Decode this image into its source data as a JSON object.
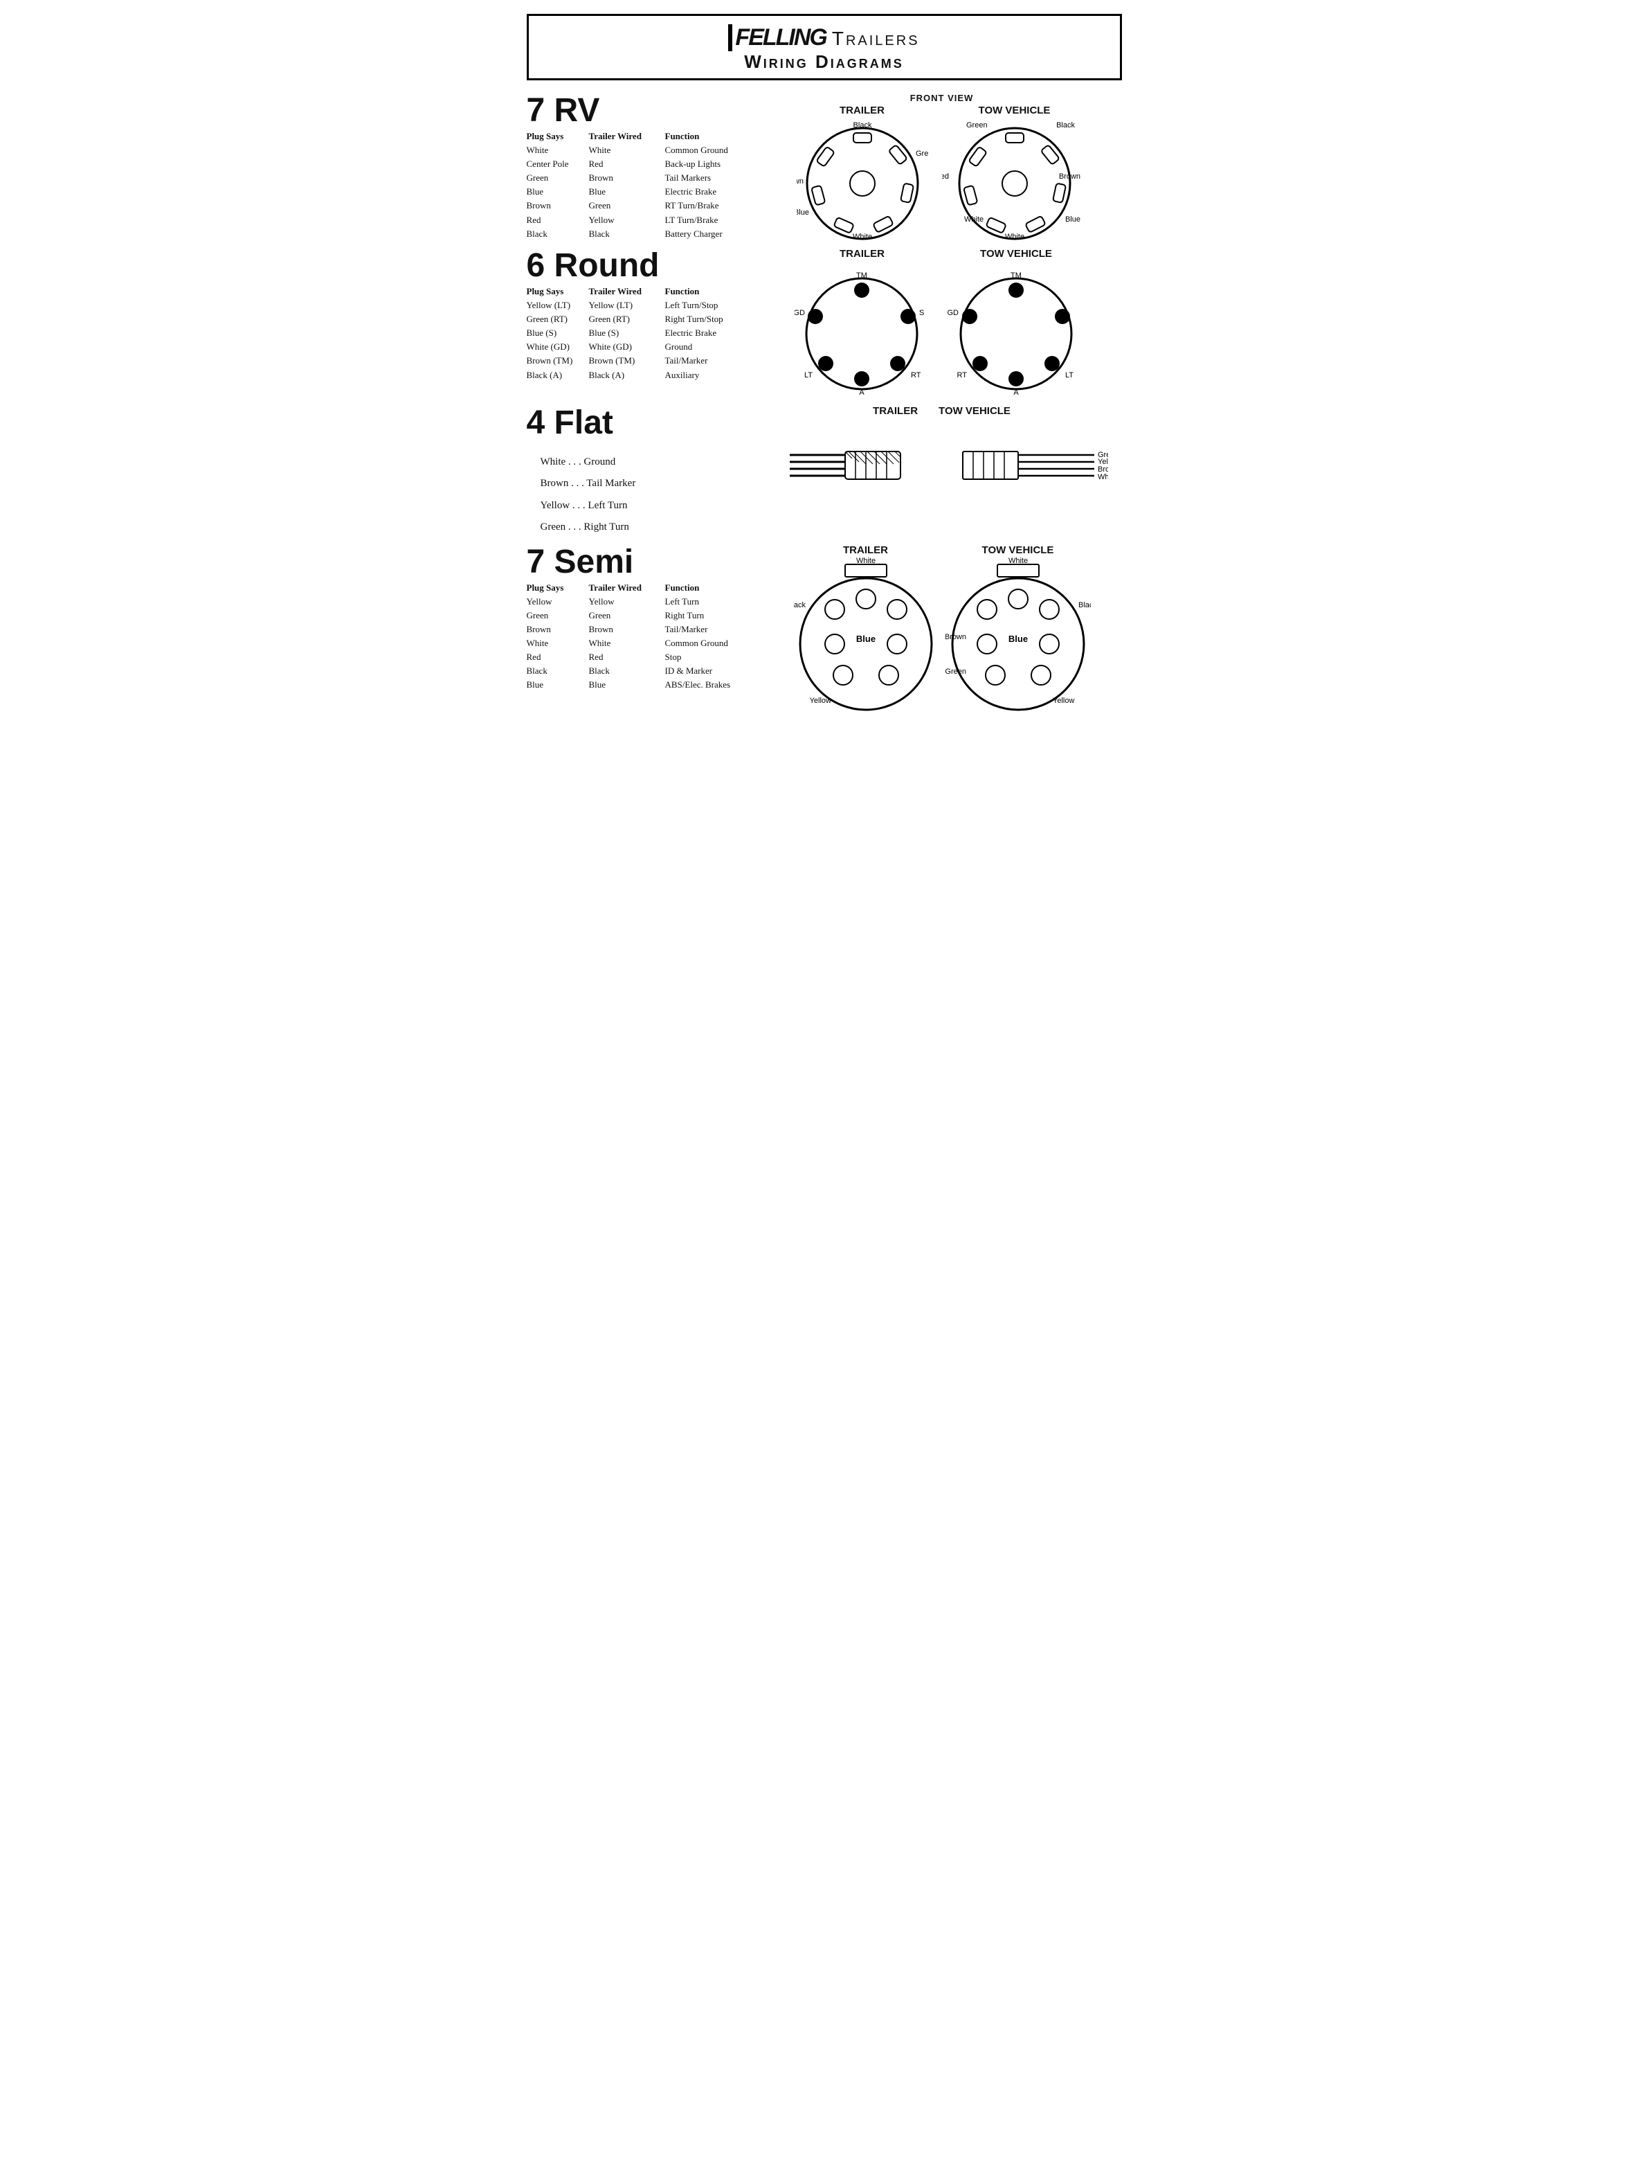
{
  "header": {
    "logo": "⊣FELLING",
    "line1": "Trailers",
    "line2": "Wiring Diagrams"
  },
  "frontView": "FRONT VIEW",
  "sections": {
    "rv7": {
      "title": "7 RV",
      "headers": [
        "Plug Says",
        "Trailer Wired",
        "Function"
      ],
      "rows": [
        [
          "White",
          "White",
          "Common Ground"
        ],
        [
          "Center Pole",
          "Red",
          "Back-up Lights"
        ],
        [
          "Green",
          "Brown",
          "Tail Markers"
        ],
        [
          "Blue",
          "Blue",
          "Electric Brake"
        ],
        [
          "Brown",
          "Green",
          "RT Turn/Brake"
        ],
        [
          "Red",
          "Yellow",
          "LT Turn/Brake"
        ],
        [
          "Black",
          "Black",
          "Battery Charger"
        ]
      ]
    },
    "round6": {
      "title": "6 Round",
      "headers": [
        "Plug Says",
        "Trailer Wired",
        "Function"
      ],
      "rows": [
        [
          "Yellow (LT)",
          "Yellow (LT)",
          "Left Turn/Stop"
        ],
        [
          "Green (RT)",
          "Green (RT)",
          "Right Turn/Stop"
        ],
        [
          "Blue (S)",
          "Blue (S)",
          "Electric Brake"
        ],
        [
          "White (GD)",
          "White (GD)",
          "Ground"
        ],
        [
          "Brown (TM)",
          "Brown (TM)",
          "Tail/Marker"
        ],
        [
          "Black (A)",
          "Black (A)",
          "Auxiliary"
        ]
      ]
    },
    "flat4": {
      "title": "4 Flat",
      "items": [
        "White . . . Ground",
        "Brown . . . Tail Marker",
        "Yellow . . . Left Turn",
        "Green . . . Right Turn"
      ]
    },
    "semi7": {
      "title": "7 Semi",
      "headers": [
        "Plug Says",
        "Trailer Wired",
        "Function"
      ],
      "rows": [
        [
          "Yellow",
          "Yellow",
          "Left Turn"
        ],
        [
          "Green",
          "Green",
          "Right Turn"
        ],
        [
          "Brown",
          "Brown",
          "Tail/Marker"
        ],
        [
          "White",
          "White",
          "Common Ground"
        ],
        [
          "Red",
          "Red",
          "Stop"
        ],
        [
          "Black",
          "Black",
          "ID & Marker"
        ],
        [
          "Blue",
          "Blue",
          "ABS/Elec. Brakes"
        ]
      ]
    }
  }
}
